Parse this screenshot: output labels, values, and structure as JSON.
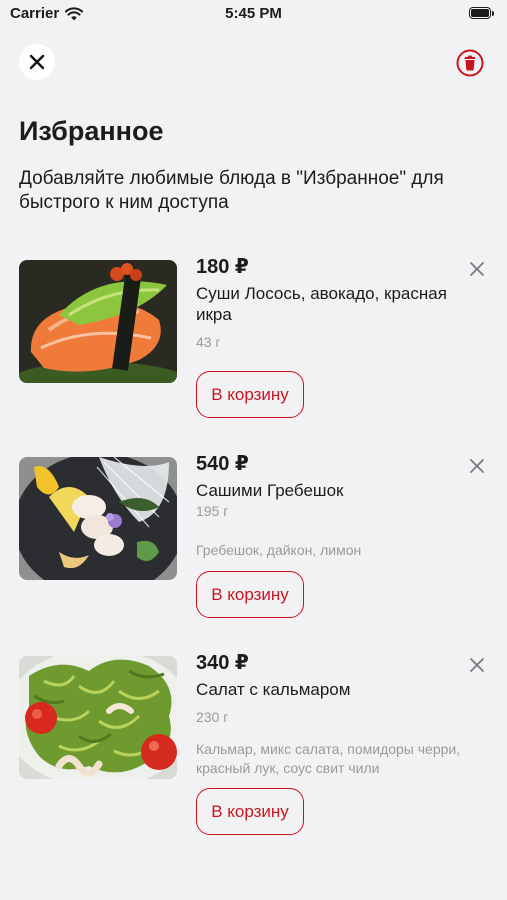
{
  "status": {
    "carrier": "Carrier",
    "time": "5:45 PM"
  },
  "header": {
    "title": "Избранное",
    "subtitle": "Добавляйте любимые блюда в \"Избранное\" для быстрого к ним доступа"
  },
  "items": [
    {
      "price": "180 ₽",
      "name": "Суши Лосось, авокадо, красная икра",
      "weight": "43 г",
      "description": "",
      "cart_label": "В корзину"
    },
    {
      "price": "540 ₽",
      "name": "Сашими Гребешок",
      "weight": "195 г",
      "description": "Гребешок, дайкон, лимон",
      "cart_label": "В корзину"
    },
    {
      "price": "340 ₽",
      "name": "Салат с кальмаром",
      "weight": "230 г",
      "description": "Кальмар, микс салата, помидоры черри, красный лук, соус свит чили",
      "cart_label": "В корзину"
    }
  ],
  "colors": {
    "accent": "#c9151f",
    "background": "#f2f2f4",
    "secondary_text": "#9a9a9e"
  },
  "icons": {
    "close": "close-icon",
    "trash": "trash-icon",
    "remove": "remove-x-icon",
    "wifi": "wifi-icon",
    "battery": "battery-icon"
  }
}
